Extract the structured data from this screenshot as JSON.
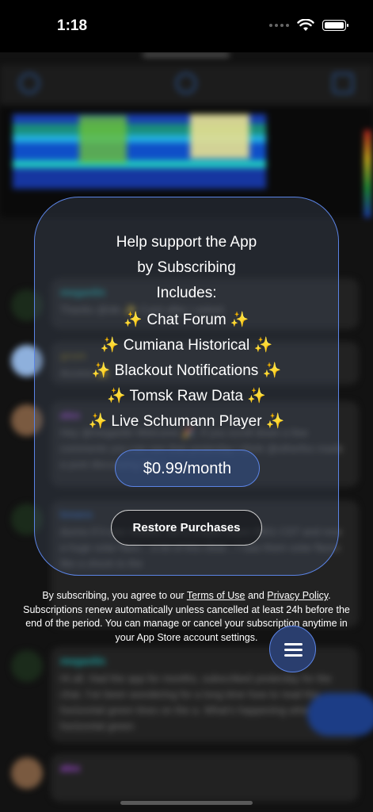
{
  "status_bar": {
    "time": "1:18"
  },
  "card": {
    "lines": [
      "Help support the App",
      "by Subscribing",
      "Includes:",
      "✨ Chat Forum ✨",
      "✨ Cumiana Historical ✨",
      "✨ Blackout Notifications ✨",
      "✨ Tomsk Raw Data ✨",
      "✨ Live Schumann Player ✨"
    ],
    "price_label": "$0.99/month",
    "restore_label": "Restore Purchases"
  },
  "legal": {
    "prefix": "By subscribing, you agree to our ",
    "terms_link": "Terms of Use",
    "and": " and ",
    "privacy_link": "Privacy Policy",
    "rest": ". Subscriptions renew automatically unless cancelled at least 24h before the end of the period. You can manage or cancel your subscription anytime in your App Store account settings."
  },
  "background_chat": [
    {
      "name": "meganlin",
      "text": "Thanks @ide ✨ Cumi after I asked."
    },
    {
      "name": "grum",
      "text": "Access ✨"
    },
    {
      "name": "alex",
      "text": "Hey @meganlin Welcome 🎉. If you scroll down a few comments you can see that yesterday I think @otherfox made a post discussing the a"
    },
    {
      "name": "kmans",
      "text": "dunno if it was related, but a couple hours 0801 CST and now a huge solar flare... a lot of this clear... I saw them solar flares like a shock to the"
    },
    {
      "name": "meganlin",
      "text": "Hi all. Had the app for months, subscribed yesterday for the chat. I've been wondering for a long time how to read the horizontal green lines on the a. What's happening when we see horizontal green"
    },
    {
      "name": "alex",
      "text": ""
    }
  ],
  "colors": {
    "accent": "#5b84e6",
    "fab": "#2a3e6e",
    "name_teal": "#18a3a3",
    "name_purple": "#a448d8",
    "name_olive": "#6c6020"
  },
  "icons": [
    "wifi-icon",
    "battery-icon",
    "gear-icon",
    "refresh-icon",
    "image-icon",
    "menu-icon"
  ]
}
